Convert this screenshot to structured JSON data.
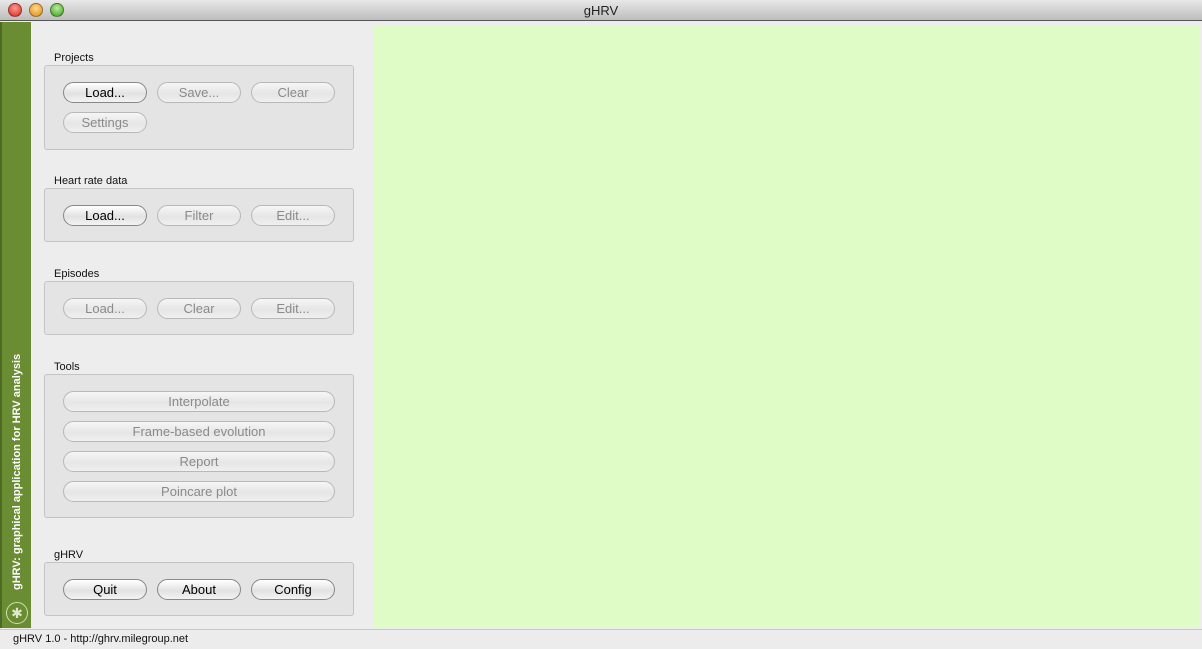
{
  "window": {
    "title": "gHRV"
  },
  "sidebar": {
    "vertical_text": "gHRV: graphical application for HRV analysis"
  },
  "groups": {
    "projects": {
      "label": "Projects",
      "load": "Load...",
      "save": "Save...",
      "clear": "Clear",
      "settings": "Settings"
    },
    "heart_rate": {
      "label": "Heart rate data",
      "load": "Load...",
      "filter": "Filter",
      "edit": "Edit..."
    },
    "episodes": {
      "label": "Episodes",
      "load": "Load...",
      "clear": "Clear",
      "edit": "Edit..."
    },
    "tools": {
      "label": "Tools",
      "interpolate": "Interpolate",
      "frame": "Frame-based evolution",
      "report": "Report",
      "poincare": "Poincare plot"
    },
    "ghrv": {
      "label": "gHRV",
      "quit": "Quit",
      "about": "About",
      "config": "Config"
    }
  },
  "status": {
    "text": "gHRV 1.0 - http://ghrv.milegroup.net"
  },
  "colors": {
    "sidebar": "#6a8c33",
    "main": "#dffbc6"
  }
}
